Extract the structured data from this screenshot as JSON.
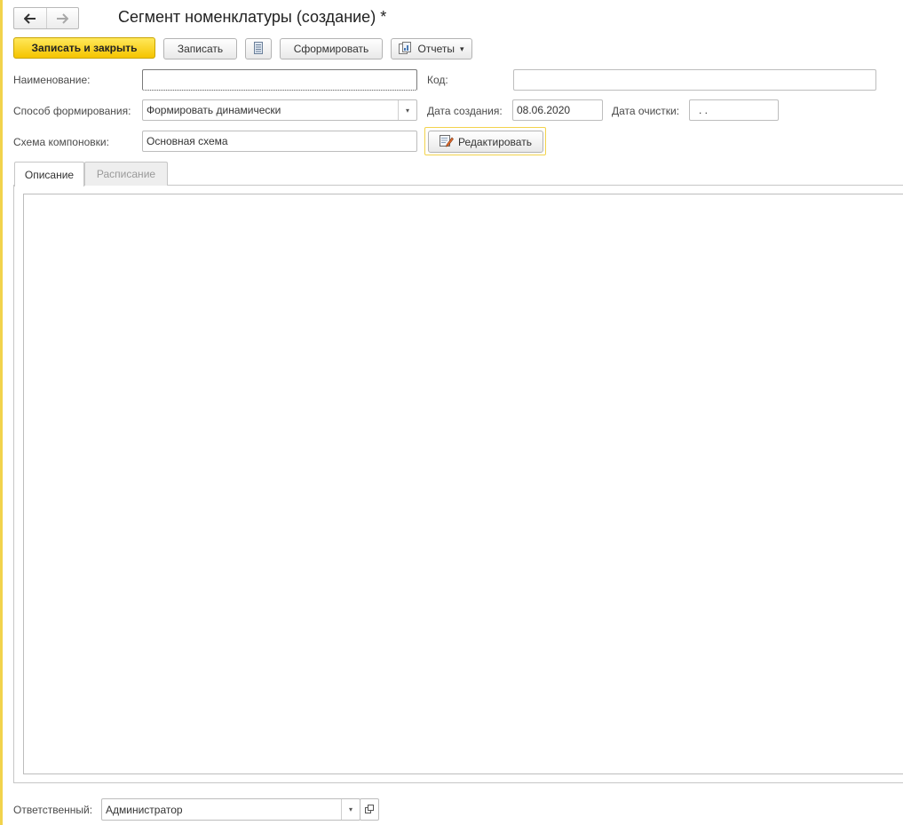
{
  "window": {
    "title": "Сегмент номенклатуры (создание) *"
  },
  "nav": {
    "back_glyph": "🡐",
    "forward_glyph": "🡒"
  },
  "toolbar": {
    "save_close_label": "Записать и закрыть",
    "save_label": "Записать",
    "generate_label": "Сформировать",
    "reports_label": "Отчеты",
    "reports_caret": "▾"
  },
  "form": {
    "name": {
      "label": "Наименование:",
      "value": ""
    },
    "code": {
      "label": "Код:",
      "value": ""
    },
    "method": {
      "label": "Способ формирования:",
      "value": "Формировать динамически"
    },
    "created": {
      "label": "Дата создания:",
      "value": "08.06.2020"
    },
    "cleared": {
      "label": "Дата очистки:",
      "value": " .  ."
    },
    "scheme": {
      "label": "Схема компоновки:",
      "value": "Основная схема"
    },
    "edit_button_label": "Редактировать"
  },
  "tabs": [
    {
      "label": "Описание",
      "active": true
    },
    {
      "label": "Расписание",
      "active": false
    }
  ],
  "description": {
    "value": ""
  },
  "responsible": {
    "label": "Ответственный:",
    "value": "Администратор"
  },
  "colors": {
    "accent": "#f5c400",
    "accent_border": "#c9a500",
    "focus_frame": "#f2d34c"
  },
  "icons": [
    "back-arrow-icon",
    "forward-arrow-icon",
    "document-list-icon",
    "reports-icon",
    "edit-scheme-icon",
    "open-icon"
  ]
}
